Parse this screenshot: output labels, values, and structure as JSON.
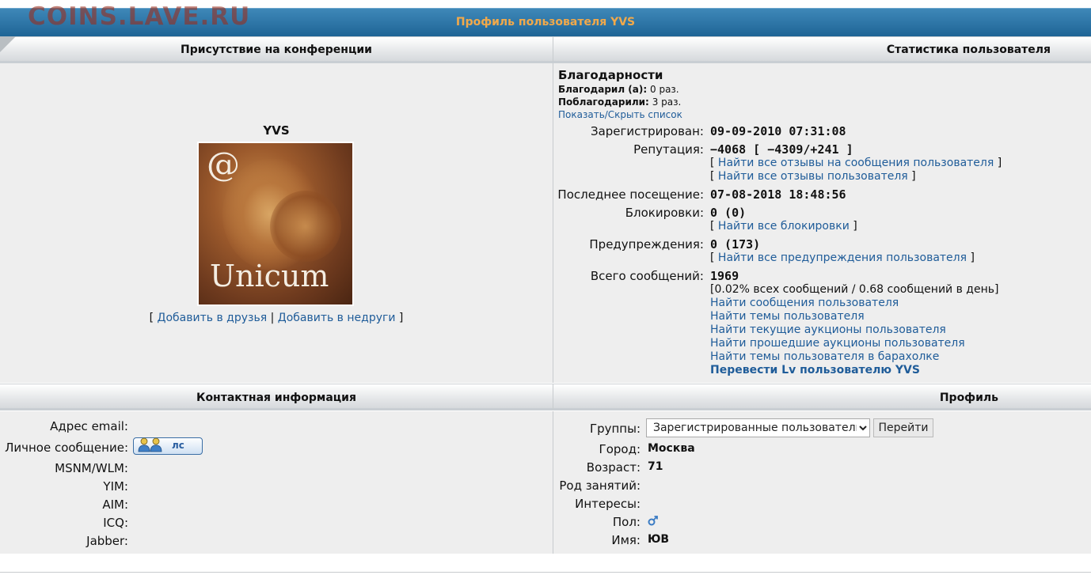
{
  "watermark": "COINS.LAVE.RU",
  "page_title": "Профиль пользователя YVS",
  "headers": {
    "presence": "Присутствие на конференции",
    "stats": "Статистика пользователя",
    "contact": "Контактная информация",
    "profile": "Профиль"
  },
  "user": {
    "name": "YVS",
    "avatar_text_top": "@",
    "avatar_text_bottom": "Unicum",
    "add_friends": "Добавить в друзья",
    "add_enemies": "Добавить в недруги"
  },
  "thanks": {
    "title": "Благодарности",
    "gave_label": "Благодарил (а):",
    "gave_value": "0 раз.",
    "got_label": "Поблагодарили:",
    "got_value": "3 раз.",
    "toggle": "Показать/Скрыть список"
  },
  "stats": {
    "registered_label": "Зарегистрирован:",
    "registered_value": "09-09-2010 07:31:08",
    "reputation_label": "Репутация:",
    "reputation_value": "−4068 [ −4309/+241 ]",
    "rep_link1": "Найти все отзывы на сообщения пользователя",
    "rep_link2": "Найти все отзывы пользователя",
    "last_visit_label": "Последнее посещение:",
    "last_visit_value": "07-08-2018 18:48:56",
    "blocks_label": "Блокировки:",
    "blocks_value": "0 (0)",
    "blocks_link": "Найти все блокировки",
    "warnings_label": "Предупреждения:",
    "warnings_value": "0 (173)",
    "warnings_link": "Найти все предупреждения пользователя",
    "posts_label": "Всего сообщений:",
    "posts_value": "1969",
    "posts_detail": "[0.02% всех сообщений / 0.68 сообщений в день]",
    "links": [
      "Найти сообщения пользователя",
      "Найти темы пользователя",
      "Найти текущие аукционы пользователя",
      "Найти прошедшие аукционы пользователя",
      "Найти темы пользователя в барахолке"
    ],
    "transfer": "Перевести Lv пользователю YVS"
  },
  "contact": {
    "email": "Адрес email:",
    "pm": "Личное сообщение:",
    "pm_button": "лс",
    "msn": "MSNM/WLM:",
    "yim": "YIM:",
    "aim": "AIM:",
    "icq": "ICQ:",
    "jabber": "Jabber:"
  },
  "profile": {
    "groups_label": "Группы:",
    "groups_selected": "Зарегистрированные пользователи",
    "go_button": "Перейти",
    "city_label": "Город:",
    "city_value": "Москва",
    "age_label": "Возраст:",
    "age_value": "71",
    "occupation_label": "Род занятий:",
    "interests_label": "Интересы:",
    "gender_label": "Пол:",
    "gender_icon": "male-icon",
    "name_label": "Имя:",
    "name_value": "ЮВ"
  },
  "colors": {
    "titlebar": "#2a73a6",
    "title_text": "#f2a94a",
    "link": "#1f5c99",
    "cell_bg": "#eeeeee"
  }
}
